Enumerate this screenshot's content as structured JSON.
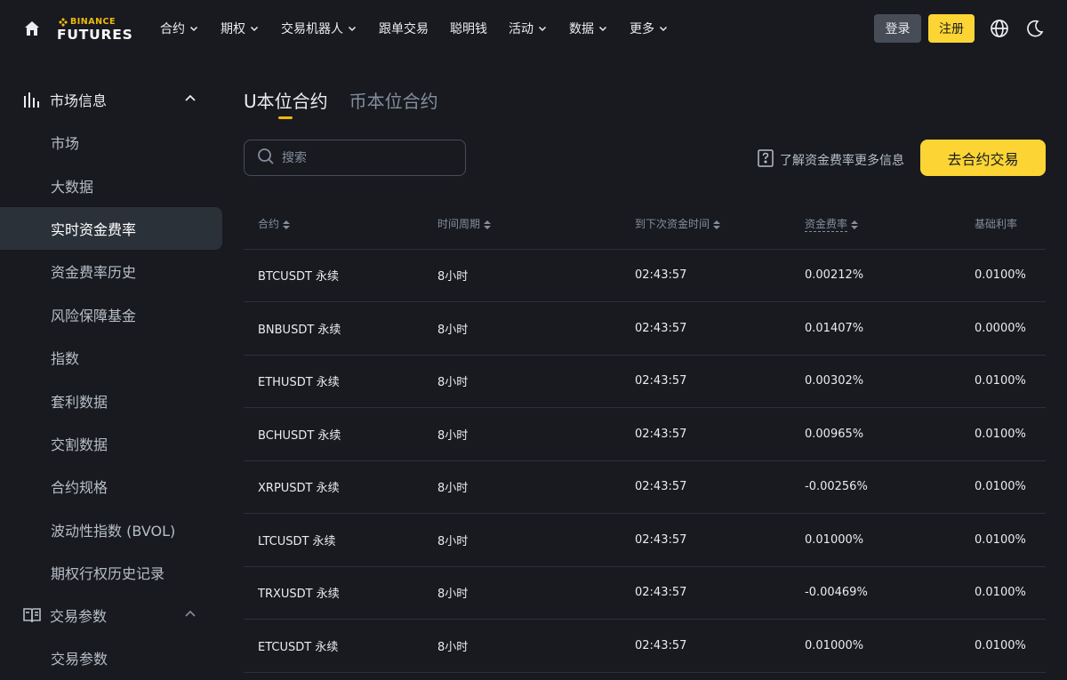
{
  "nav": {
    "logo_top": "BINANCE",
    "logo_bottom": "FUTURES",
    "menu": [
      {
        "label": "合约",
        "chevron": true
      },
      {
        "label": "期权",
        "chevron": true
      },
      {
        "label": "交易机器人",
        "chevron": true
      },
      {
        "label": "跟单交易",
        "chevron": false
      },
      {
        "label": "聪明钱",
        "chevron": false
      },
      {
        "label": "活动",
        "chevron": true
      },
      {
        "label": "数据",
        "chevron": true
      },
      {
        "label": "更多",
        "chevron": true
      }
    ],
    "login_label": "登录",
    "register_label": "注册",
    "icons": [
      "home-icon",
      "globe-icon",
      "moon-icon"
    ]
  },
  "sidebar": {
    "group1_label": "市场信息",
    "items": [
      "市场",
      "大数据",
      "实时资金费率",
      "资金费率历史",
      "风险保障基金",
      "指数",
      "套利数据",
      "交割数据",
      "合约规格",
      "波动性指数 (BVOL)",
      "期权行权历史记录"
    ],
    "active_index": 2,
    "group2_label": "交易参数",
    "group2_first_item": "交易参数"
  },
  "main": {
    "tabs": [
      "U本位合约",
      "币本位合约"
    ],
    "active_tab": 0,
    "search_placeholder": "搜索",
    "info_link": "了解资金费率更多信息",
    "trade_button": "去合约交易",
    "columns": [
      "合约",
      "时间周期",
      "到下次资金时间",
      "资金费率",
      "基础利率"
    ],
    "rows": [
      {
        "contract": "BTCUSDT 永续",
        "period": "8小时",
        "next": "02:43:57",
        "rate": "0.00212%",
        "base": "0.0100%"
      },
      {
        "contract": "BNBUSDT 永续",
        "period": "8小时",
        "next": "02:43:57",
        "rate": "0.01407%",
        "base": "0.0000%"
      },
      {
        "contract": "ETHUSDT 永续",
        "period": "8小时",
        "next": "02:43:57",
        "rate": "0.00302%",
        "base": "0.0100%"
      },
      {
        "contract": "BCHUSDT 永续",
        "period": "8小时",
        "next": "02:43:57",
        "rate": "0.00965%",
        "base": "0.0100%"
      },
      {
        "contract": "XRPUSDT 永续",
        "period": "8小时",
        "next": "02:43:57",
        "rate": "-0.00256%",
        "base": "0.0100%"
      },
      {
        "contract": "LTCUSDT 永续",
        "period": "8小时",
        "next": "02:43:57",
        "rate": "0.01000%",
        "base": "0.0100%"
      },
      {
        "contract": "TRXUSDT 永续",
        "period": "8小时",
        "next": "02:43:57",
        "rate": "-0.00469%",
        "base": "0.0100%"
      },
      {
        "contract": "ETCUSDT 永续",
        "period": "8小时",
        "next": "02:43:57",
        "rate": "0.01000%",
        "base": "0.0100%"
      }
    ]
  },
  "colors": {
    "background": "#181a20",
    "accent": "#fcd535",
    "active_bg": "#2b3139",
    "muted_text": "#848e9c"
  }
}
